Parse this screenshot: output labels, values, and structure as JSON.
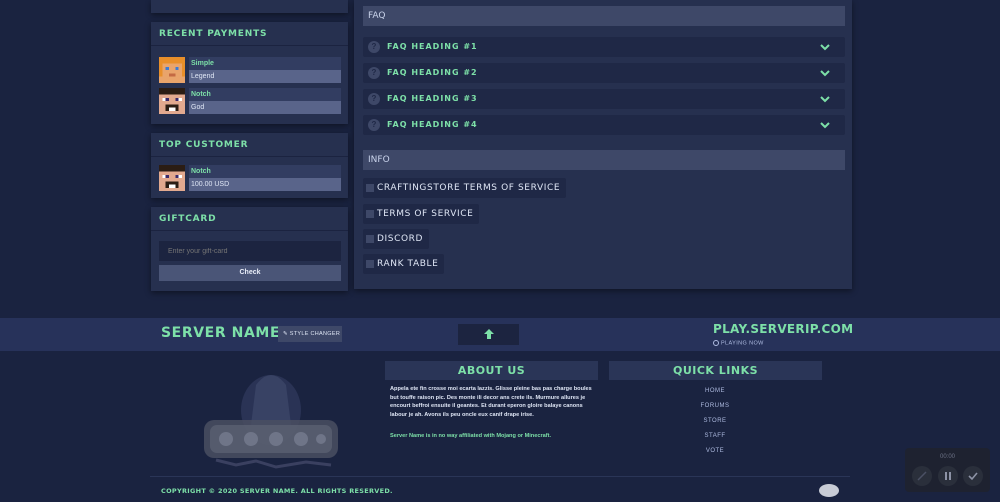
{
  "sidebar": {
    "recent_payments": {
      "title": "RECENT PAYMENTS",
      "items": [
        {
          "name": "Simple",
          "rank": "Legend"
        },
        {
          "name": "Notch",
          "rank": "God"
        }
      ]
    },
    "top_customer": {
      "title": "TOP CUSTOMER",
      "name": "Notch",
      "amount": "100.00 USD"
    },
    "giftcard": {
      "title": "GIFTCARD",
      "placeholder": "Enter your gift-card",
      "button": "Check"
    }
  },
  "main": {
    "faq": {
      "title": "FAQ",
      "items": [
        "FAQ HEADING #1",
        "FAQ HEADING #2",
        "FAQ HEADING #3",
        "FAQ HEADING #4"
      ]
    },
    "info": {
      "title": "INFO",
      "links": [
        "CRAFTINGSTORE TERMS OF SERVICE",
        "TERMS OF SERVICE",
        "DISCORD",
        "RANK TABLE"
      ]
    }
  },
  "bar": {
    "server_name": "SERVER NAME",
    "style_changer": "STYLE CHANGER",
    "server_ip": "PLAY.SERVERIP.COM",
    "playing_now": "PLAYING NOW"
  },
  "footer": {
    "about": {
      "title": "ABOUT US",
      "text": "Appela ete fin crosse moi ecarta lazzis. Glisse pleine bas pas charge boules but touffe raison pic. Des monte ili decor ans crete ils. Murmure allures je encourt beffroi ensuite il geantes. Et durant eperon gloire balaye canons labour je ah. Avons ils peu oncle eux canif drape irise.",
      "disclaimer": "Server Name is in no way affiliated with Mojang or Minecraft."
    },
    "quick_links": {
      "title": "QUICK LINKS",
      "items": [
        "HOME",
        "FORUMS",
        "STORE",
        "STAFF",
        "VOTE"
      ]
    },
    "copyright": "COPYRIGHT © 2020 SERVER NAME. ALL RIGHTS RESERVED."
  },
  "player": {
    "time": "00:00"
  },
  "colors": {
    "accent": "#7de0a8",
    "background": "#1a2340",
    "panel": "#26304f"
  }
}
